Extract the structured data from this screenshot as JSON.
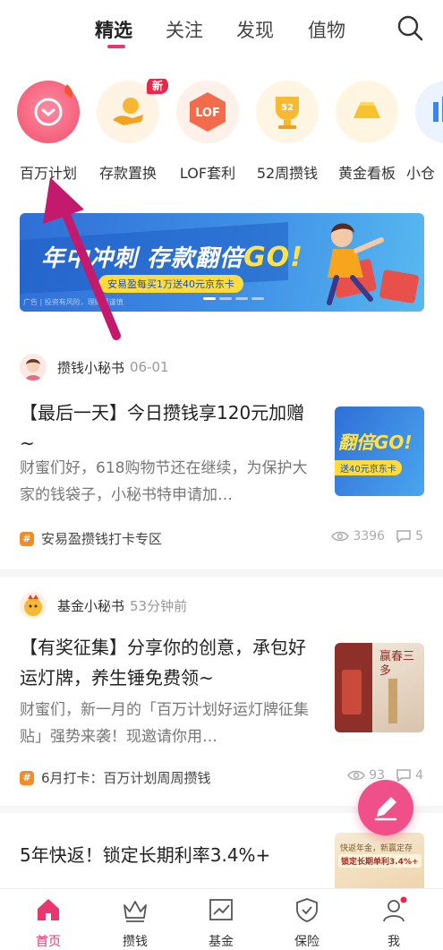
{
  "top_tabs": [
    "精选",
    "关注",
    "发现",
    "值物"
  ],
  "shortcuts": [
    {
      "label": "百万计划",
      "icon": "piggy-coin-icon"
    },
    {
      "label": "存款置换",
      "icon": "hand-coin-icon",
      "badge": "新"
    },
    {
      "label": "LOF套利",
      "icon": "lof-icon",
      "icon_text": "LOF"
    },
    {
      "label": "52周攒钱",
      "icon": "trophy-icon",
      "icon_text": "52"
    },
    {
      "label": "黄金看板",
      "icon": "gold-bar-icon"
    },
    {
      "label": "小仓",
      "icon": "chart-icon"
    }
  ],
  "banner": {
    "title_prefix": "年中冲刺 存款翻倍",
    "title_go": "GO!",
    "subtitle": "安易盈每买1万送40元京东卡",
    "ad_text": "广告 | 投资有风险，理财需谨慎"
  },
  "posts": [
    {
      "author": "攒钱小秘书",
      "time": "06-01",
      "title": "【最后一天】今日攒钱享120元加赠 ~",
      "summary": "财蜜们好，618购物节还在继续，为保护大家的钱袋子，小秘书特申请加…",
      "topic": "安易盈攒钱打卡专区",
      "views": "3396",
      "comments": "5",
      "thumb_text": "翻倍GO!",
      "thumb_sub": "送40元京东卡"
    },
    {
      "author": "基金小秘书",
      "time": "53分钟前",
      "title": "【有奖征集】分享你的创意，承包好运灯牌，养生锤免费领~",
      "summary": "财蜜们，新一月的「百万计划好运灯牌征集贴」强势来袭！现邀请你用…",
      "topic": "6月打卡：百万计划周周攒钱",
      "views": "93",
      "comments": "4",
      "thumb_text": "赢春三多"
    },
    {
      "title": "5年快返！锁定长期利率3.4%+",
      "thumb_line1": "快返年金，新赢定存",
      "thumb_line2": "锁定长期单利3.4%+"
    }
  ],
  "bottom_nav": [
    {
      "label": "首页",
      "icon": "home-icon",
      "active": true
    },
    {
      "label": "攒钱",
      "icon": "crown-icon"
    },
    {
      "label": "基金",
      "icon": "trend-chart-icon"
    },
    {
      "label": "保险",
      "icon": "shield-icon"
    },
    {
      "label": "我",
      "icon": "profile-icon"
    }
  ],
  "colors": {
    "accent": "#e8376f",
    "banner_blue": "#3f8fe6",
    "topic_orange": "#f28c28"
  }
}
